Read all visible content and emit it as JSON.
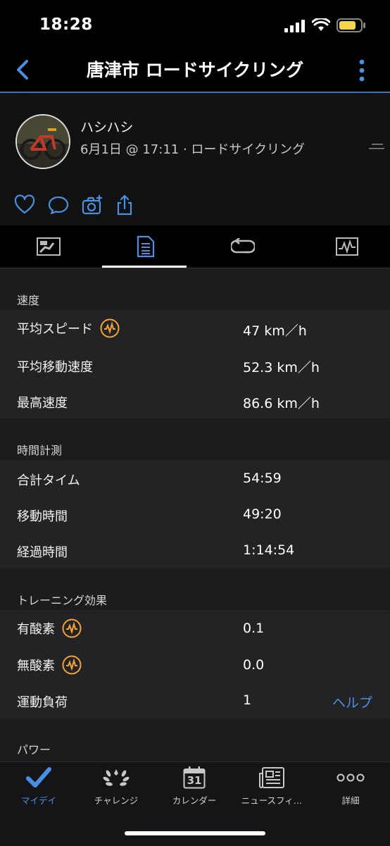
{
  "status_bar": {
    "time": "18:28"
  },
  "nav": {
    "title": "唐津市 ロードサイクリング",
    "back_icon": "chevron-left-icon",
    "menu_icon": "more-vertical-icon"
  },
  "profile": {
    "user_name": "ハシハシ",
    "activity_meta": "6月1日 @ 17:11 · ロードサイクリング"
  },
  "actions": [
    "like-icon",
    "comment-icon",
    "camera-add-icon",
    "share-icon"
  ],
  "tabs": [
    {
      "name": "map-tab",
      "icon": "map-icon"
    },
    {
      "name": "stats-tab",
      "icon": "list-document-icon",
      "active": true
    },
    {
      "name": "laps-tab",
      "icon": "laps-icon"
    },
    {
      "name": "charts-tab",
      "icon": "chart-icon"
    }
  ],
  "sections": {
    "speed": {
      "title": "速度",
      "rows": [
        {
          "label": "平均スピード",
          "value": "47 km／h"
        },
        {
          "label": "平均移動速度",
          "value": "52.3 km／h"
        },
        {
          "label": "最高速度",
          "value": "86.6 km／h"
        }
      ]
    },
    "timing": {
      "title": "時間計測",
      "rows": [
        {
          "label": "合計タイム",
          "value": "54:59"
        },
        {
          "label": "移動時間",
          "value": "49:20"
        },
        {
          "label": "経過時間",
          "value": "1:14:54"
        }
      ]
    },
    "training": {
      "title": "トレーニング効果",
      "rows": [
        {
          "label": "有酸素",
          "value": "0.1"
        },
        {
          "label": "無酸素",
          "value": "0.0"
        },
        {
          "label": "運動負荷",
          "value": "1",
          "link": "ヘルプ"
        }
      ]
    },
    "power": {
      "title": "パワー"
    }
  },
  "tabbar": [
    {
      "label": "マイデイ",
      "icon": "checkmark-icon",
      "active": true
    },
    {
      "label": "チャレンジ",
      "icon": "laurel-icon"
    },
    {
      "label": "カレンダー",
      "icon": "calendar-icon",
      "day": "31"
    },
    {
      "label": "ニュースフィ…",
      "icon": "newsfeed-icon"
    },
    {
      "label": "詳細",
      "icon": "more-dots-icon"
    }
  ],
  "colors": {
    "accent": "#4a90e2",
    "metric_icon": "#f2a33a",
    "background": "#1c1c1e"
  }
}
